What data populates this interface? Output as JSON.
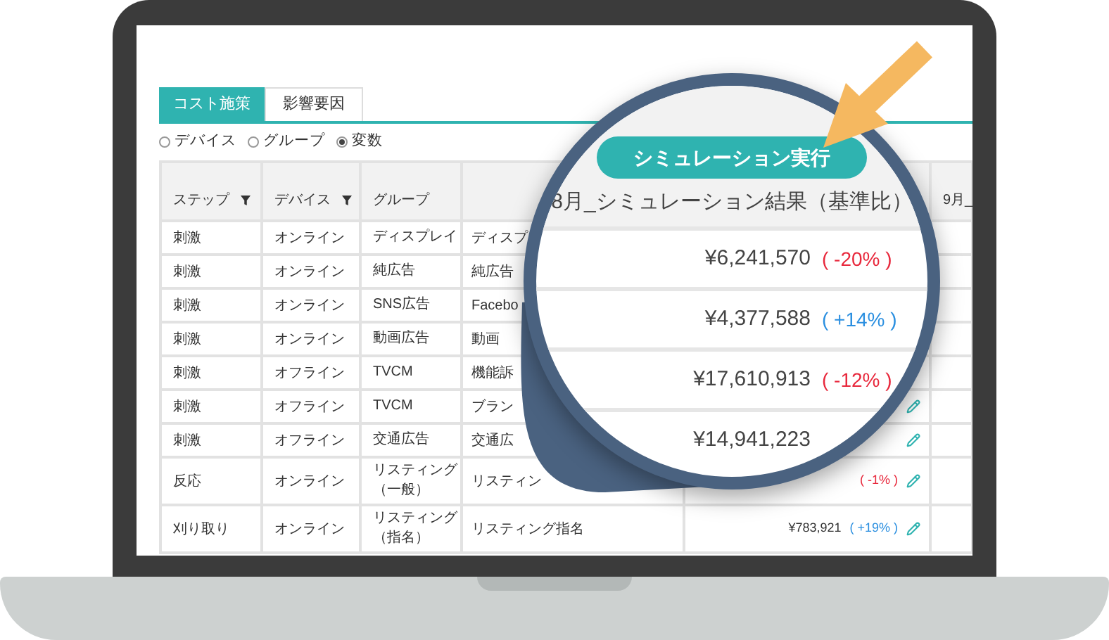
{
  "tabs": [
    {
      "label": "コスト施策",
      "selected": true
    },
    {
      "label": "影響要因",
      "selected": false
    }
  ],
  "view_options": [
    {
      "label": "デバイス",
      "selected": false
    },
    {
      "label": "グループ",
      "selected": false
    },
    {
      "label": "変数",
      "selected": true
    }
  ],
  "table": {
    "columns": [
      {
        "label": "ステップ",
        "filter": true
      },
      {
        "label": "デバイス",
        "filter": true
      },
      {
        "label": "グループ",
        "filter": false
      }
    ],
    "last_column_header": "9月_",
    "rows": [
      {
        "step": "刺激",
        "device": "オンライン",
        "group": "ディスプレイ",
        "column_4": "ディスプ"
      },
      {
        "step": "刺激",
        "device": "オンライン",
        "group": "純広告",
        "column_4": "純広告"
      },
      {
        "step": "刺激",
        "device": "オンライン",
        "group": "SNS広告",
        "column_4": "Facebo"
      },
      {
        "step": "刺激",
        "device": "オンライン",
        "group": "動画広告",
        "column_4": "動画"
      },
      {
        "step": "刺激",
        "device": "オフライン",
        "group": "TVCM",
        "column_4": "機能訴"
      },
      {
        "step": "刺激",
        "device": "オフライン",
        "group": "TVCM",
        "column_4": "ブラン",
        "pencil": true
      },
      {
        "step": "刺激",
        "device": "オフライン",
        "group": "交通広告",
        "column_4": "交通広",
        "pencil": true
      },
      {
        "step": "反応",
        "device": "オンライン",
        "group": "リスティング（一般）",
        "column_4": "リスティン",
        "change": "( -1% )",
        "color": "#e8283c",
        "pencil": true
      },
      {
        "step": "刈り取り",
        "device": "オンライン",
        "group": "リスティング（指名）",
        "column_4": "リスティング指名",
        "amount": "¥783,921",
        "change": "( +19% )",
        "color": "#2b8fe0",
        "pencil": true
      }
    ]
  },
  "magnifier": {
    "button": "シミュレーション実行",
    "header": "8月_シミュレーション結果（基準比）",
    "rows": [
      {
        "amount": "¥6,241,570",
        "change": "( -20% )",
        "color": "#e8283c"
      },
      {
        "amount": "¥4,377,588",
        "change": "( +14% )",
        "color": "#2b8fe0"
      },
      {
        "amount": "¥17,610,913",
        "change": "( -12% )",
        "color": "#e8283c"
      },
      {
        "amount": "¥14,941,223"
      }
    ]
  }
}
